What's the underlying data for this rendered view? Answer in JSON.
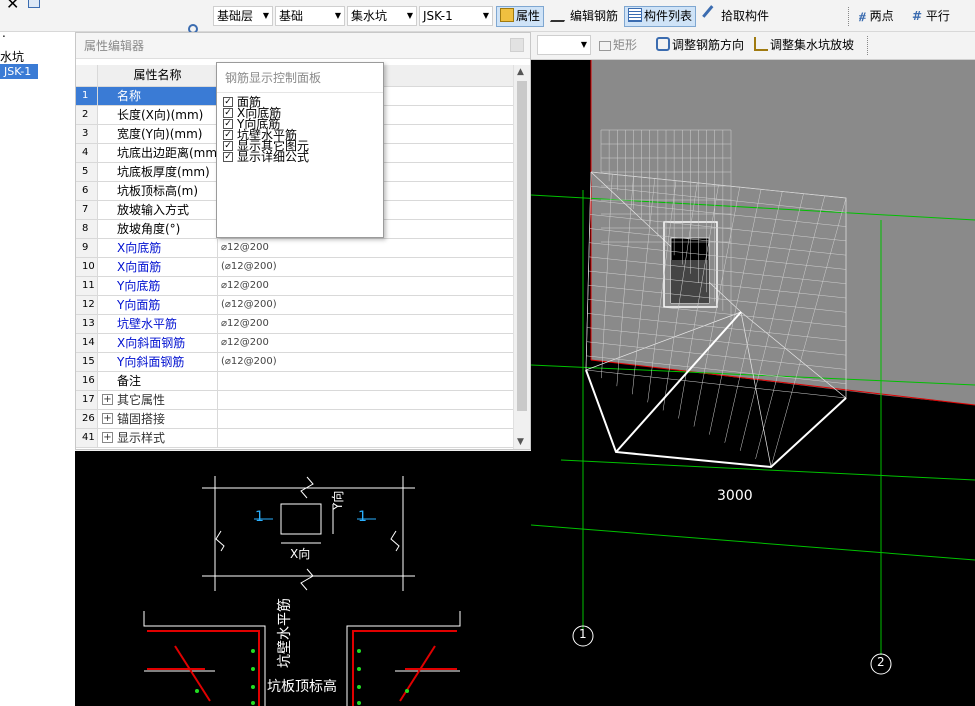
{
  "toolbar": {
    "floor": "基础层",
    "category": "基础",
    "type": "集水坑",
    "component": "JSK-1",
    "btn_property": "属性",
    "btn_edit_rebar": "编辑钢筋",
    "btn_component_list": "构件列表",
    "btn_pick": "拾取构件",
    "btn_two_points": "两点",
    "btn_parallel": "平行"
  },
  "left_panel": {
    "dot": ".",
    "tree_label": "水坑",
    "selected_item": "JSK-1"
  },
  "property_editor": {
    "title": "属性编辑器",
    "header_name": "属性名称",
    "rows": [
      {
        "num": "1",
        "name": "名称",
        "value": ""
      },
      {
        "num": "2",
        "name": "长度(X向)(mm)",
        "value": ""
      },
      {
        "num": "3",
        "name": "宽度(Y向)(mm)",
        "value": ""
      },
      {
        "num": "4",
        "name": "坑底出边距离(mm)",
        "value": ""
      },
      {
        "num": "5",
        "name": "坑底板厚度(mm)",
        "value": ""
      },
      {
        "num": "6",
        "name": "坑板顶标高(m)",
        "value": ""
      },
      {
        "num": "7",
        "name": "放坡输入方式",
        "value": ""
      },
      {
        "num": "8",
        "name": "放坡角度(°)",
        "value": ""
      },
      {
        "num": "9",
        "name": "X向底筋",
        "value": "⌀12@200"
      },
      {
        "num": "10",
        "name": "X向面筋",
        "value": "(⌀12@200)"
      },
      {
        "num": "11",
        "name": "Y向底筋",
        "value": "⌀12@200"
      },
      {
        "num": "12",
        "name": "Y向面筋",
        "value": "(⌀12@200)"
      },
      {
        "num": "13",
        "name": "坑壁水平筋",
        "value": "⌀12@200"
      },
      {
        "num": "14",
        "name": "X向斜面钢筋",
        "value": "⌀12@200"
      },
      {
        "num": "15",
        "name": "Y向斜面钢筋",
        "value": "(⌀12@200)"
      },
      {
        "num": "16",
        "name": "备注",
        "value": ""
      }
    ],
    "groups": [
      {
        "num": "17",
        "name": "其它属性"
      },
      {
        "num": "26",
        "name": "锚固搭接"
      },
      {
        "num": "41",
        "name": "显示样式"
      }
    ]
  },
  "rebar_panel": {
    "title": "钢筋显示控制面板",
    "options": [
      "面筋",
      "X向底筋",
      "Y向底筋",
      "坑壁水平筋",
      "显示其它图元",
      "显示详细公式"
    ]
  },
  "preview": {
    "label_left": "1",
    "label_right": "1",
    "label_x": "X向",
    "label_y": "Y向",
    "label_wall": "坑壁水平筋",
    "label_top": "坑板顶标高"
  },
  "right_toolbar": {
    "btn_rect": "矩形",
    "btn_adjust_dir": "调整钢筋方向",
    "btn_adjust_slope": "调整集水坑放坡"
  },
  "viewport": {
    "dimension": "3000",
    "axis_1": "1",
    "axis_2": "2"
  },
  "colors": {
    "selection": "#3a7bd5",
    "blue_text": "#0010d0",
    "grid_green": "#00c000",
    "cad_red": "#e00000"
  }
}
